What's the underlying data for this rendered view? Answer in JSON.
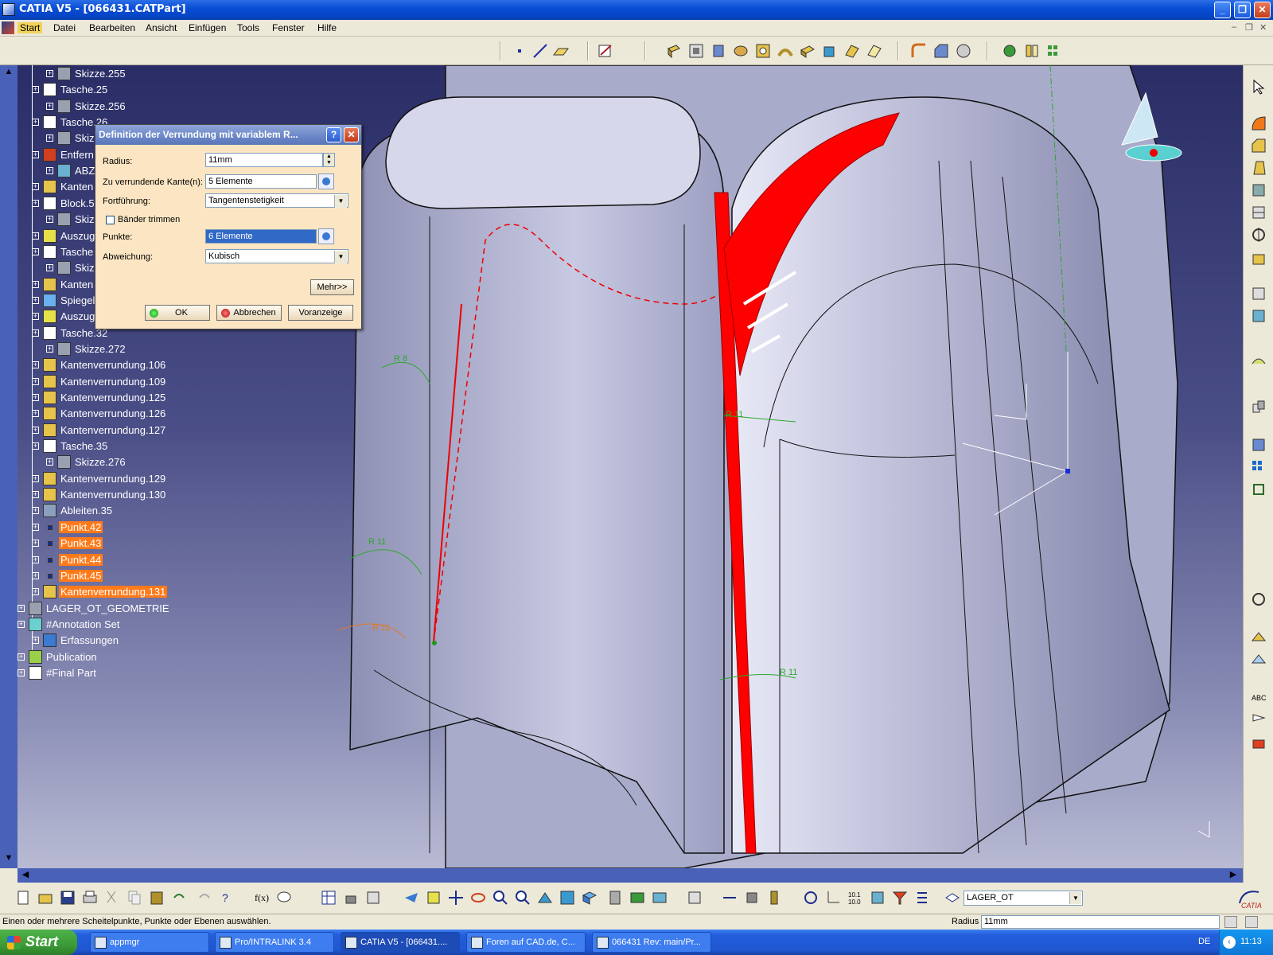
{
  "window": {
    "title": "CATIA V5 - [066431.CATPart]",
    "buttons": [
      "_",
      "❐",
      "✕"
    ]
  },
  "menu": {
    "items": [
      "Start",
      "Datei",
      "Bearbeiten",
      "Ansicht",
      "Einfügen",
      "Tools",
      "Fenster",
      "Hilfe"
    ],
    "active": "Start",
    "mdi_controls": [
      "–",
      "❐",
      "✕"
    ]
  },
  "tree": {
    "nodes": [
      {
        "label": "Skizze.255",
        "icon": "sketch-icon"
      },
      {
        "label": "Tasche.25",
        "icon": "pocket-icon"
      },
      {
        "label": "Skizze.256",
        "icon": "sketch-icon"
      },
      {
        "label": "Tasche.26",
        "icon": "pocket-icon"
      },
      {
        "label": "Skizz",
        "icon": "sketch-icon"
      },
      {
        "label": "Entfern",
        "icon": "remove-icon"
      },
      {
        "label": "ABZ",
        "icon": "body-icon"
      },
      {
        "label": "Kanten",
        "icon": "fillet-icon"
      },
      {
        "label": "Block.5",
        "icon": "pad-icon"
      },
      {
        "label": "Skizz",
        "icon": "sketch-icon"
      },
      {
        "label": "Auszug",
        "icon": "draft-icon"
      },
      {
        "label": "Tasche",
        "icon": "pocket-icon"
      },
      {
        "label": "Skizz",
        "icon": "sketch-icon"
      },
      {
        "label": "Kanten",
        "icon": "fillet-icon"
      },
      {
        "label": "Spiegel",
        "icon": "mirror-icon"
      },
      {
        "label": "Auszug",
        "icon": "draft-icon"
      },
      {
        "label": "Tasche.32",
        "icon": "pocket-icon"
      },
      {
        "label": "Skizze.272",
        "icon": "sketch-icon"
      },
      {
        "label": "Kantenverrundung.106",
        "icon": "fillet-icon"
      },
      {
        "label": "Kantenverrundung.109",
        "icon": "fillet-icon"
      },
      {
        "label": "Kantenverrundung.125",
        "icon": "fillet-icon"
      },
      {
        "label": "Kantenverrundung.126",
        "icon": "fillet-icon"
      },
      {
        "label": "Kantenverrundung.127",
        "icon": "fillet-icon"
      },
      {
        "label": "Tasche.35",
        "icon": "pocket-icon"
      },
      {
        "label": "Skizze.276",
        "icon": "sketch-icon"
      },
      {
        "label": "Kantenverrundung.129",
        "icon": "fillet-icon"
      },
      {
        "label": "Kantenverrundung.130",
        "icon": "fillet-icon"
      },
      {
        "label": "Ableiten.35",
        "icon": "derive-icon"
      },
      {
        "label": "Punkt.42",
        "icon": "point-icon",
        "highlighted": true
      },
      {
        "label": "Punkt.43",
        "icon": "point-icon",
        "highlighted": true
      },
      {
        "label": "Punkt.44",
        "icon": "point-icon",
        "highlighted": true
      },
      {
        "label": "Punkt.45",
        "icon": "point-icon",
        "highlighted": true
      },
      {
        "label": "Kantenverrundung.131",
        "icon": "fillet-icon",
        "highlighted": true
      },
      {
        "label": "LAGER_OT_GEOMETRIE",
        "icon": "geometry-set-icon"
      },
      {
        "label": "#Annotation Set",
        "icon": "annotation-icon"
      },
      {
        "label": "Erfassungen",
        "icon": "capture-icon"
      },
      {
        "label": "Publication",
        "icon": "publication-icon"
      },
      {
        "label": "#Final Part",
        "icon": "final-part-icon"
      }
    ]
  },
  "dialog": {
    "title": "Definition der Verrundung mit variablem R...",
    "help_label": "?",
    "close_label": "✕",
    "radius_label": "Radius:",
    "radius_value": "11mm",
    "edges_label": "Zu verrundende Kante(n):",
    "edges_value": "5 Elemente",
    "propagation_label": "Fortführung:",
    "propagation_value": "Tangentenstetigkeit",
    "trim_label": "Bänder trimmen",
    "trim_checked": false,
    "points_label": "Punkte:",
    "points_value": "6 Elemente",
    "variation_label": "Abweichung:",
    "variation_value": "Kubisch",
    "more_label": "Mehr>>",
    "ok_label": "OK",
    "cancel_label": "Abbrechen",
    "preview_label": "Voranzeige"
  },
  "viewport": {
    "radius_annotations": [
      "R 8",
      "R 11",
      "R 11",
      "R 11",
      "R 11"
    ]
  },
  "bottom_toolbar": {
    "layer_value": "LAGER_OT"
  },
  "status": {
    "message": "Einen oder mehrere Scheitelpunkte, Punkte oder Ebenen auswählen.",
    "radius_label": "Radius",
    "radius_value": "11mm"
  },
  "taskbar": {
    "start_label": "Start",
    "tasks": [
      {
        "label": "appmgr",
        "active": false
      },
      {
        "label": "Pro/INTRALINK 3.4",
        "active": false
      },
      {
        "label": "CATIA V5 - [066431....",
        "active": true
      },
      {
        "label": "Foren auf CAD.de, C...",
        "active": false
      },
      {
        "label": "066431 Rev: main/Pr...",
        "active": false
      }
    ],
    "language": "DE",
    "clock": "11:13"
  },
  "colors": {
    "selection_orange": "#ff7a1a",
    "fillet_red": "#ff0000",
    "annotation_green": "#2ea82e",
    "dialog_bg": "#fbe5c2"
  }
}
